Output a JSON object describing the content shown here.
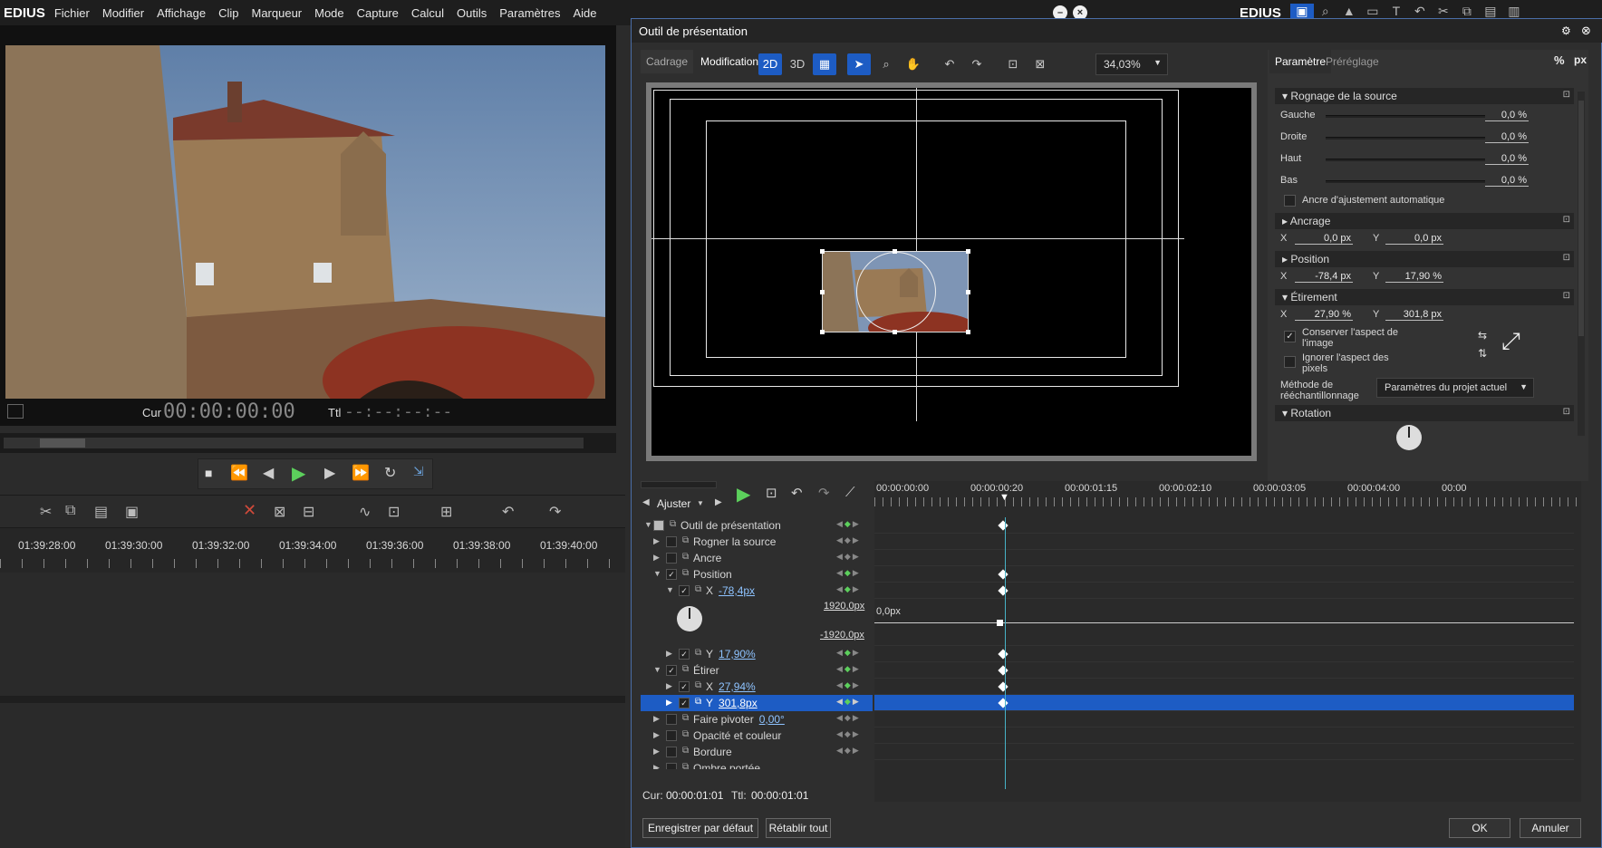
{
  "menubar": {
    "app": "EDIUS",
    "items": [
      "Fichier",
      "Modifier",
      "Affichage",
      "Clip",
      "Marqueur",
      "Mode",
      "Capture",
      "Calcul",
      "Outils",
      "Paramètres",
      "Aide"
    ]
  },
  "right_toolbar": {
    "app": "EDIUS"
  },
  "monitor": {
    "cur_label": "Cur",
    "cur_time": "00:00:00:00",
    "ttl_label": "Ttl",
    "ttl_time": "--:--:--:--"
  },
  "timeline_ruler": [
    "01:39:28:00",
    "01:39:30:00",
    "01:39:32:00",
    "01:39:34:00",
    "01:39:36:00",
    "01:39:38:00",
    "01:39:40:00"
  ],
  "dialog": {
    "title": "Outil de présentation",
    "tabs": [
      "Cadrage",
      "Modification"
    ],
    "zoom": "34,03%",
    "param_tabs": [
      "Paramètre",
      "Préréglage"
    ],
    "unit_percent": "%",
    "unit_px": "px",
    "crop": {
      "title": "Rognage de la source",
      "rows": [
        {
          "label": "Gauche",
          "value": "0,0 %"
        },
        {
          "label": "Droite",
          "value": "0,0 %"
        },
        {
          "label": "Haut",
          "value": "0,0 %"
        },
        {
          "label": "Bas",
          "value": "0,0 %"
        }
      ],
      "auto_anchor": "Ancre d'ajustement automatique"
    },
    "anchor": {
      "title": "Ancrage",
      "x_label": "X",
      "x": "0,0 px",
      "y_label": "Y",
      "y": "0,0 px"
    },
    "position": {
      "title": "Position",
      "x_label": "X",
      "x": "-78,4 px",
      "y_label": "Y",
      "y": "17,90 %"
    },
    "stretch": {
      "title": "Étirement",
      "x_label": "X",
      "x": "27,90 %",
      "y_label": "Y",
      "y": "301,8 px",
      "keep_aspect": "Conserver l'aspect de l'image",
      "ignore_pixel": "Ignorer l'aspect des pixels",
      "resample_label": "Méthode de rééchantillonnage",
      "resample_value": "Paramètres du projet actuel"
    },
    "rotation": {
      "title": "Rotation"
    },
    "kf_toolbar": {
      "fit": "Ajuster"
    },
    "kf_ruler": [
      "00:00:00:00",
      "00:00:00:20",
      "00:00:01:15",
      "00:00:02:10",
      "00:00:03:05",
      "00:00:04:00",
      "00:00"
    ],
    "kf_rows": [
      {
        "label": "Outil de présentation",
        "value": ""
      },
      {
        "label": "Rogner la source",
        "value": ""
      },
      {
        "label": "Ancre",
        "value": ""
      },
      {
        "label": "Position",
        "value": ""
      },
      {
        "label": "X",
        "value": "-78,4px"
      },
      {
        "label": "Y",
        "value": "17,90%"
      },
      {
        "label": "Étirer",
        "value": ""
      },
      {
        "label": "X",
        "value": "27,94%"
      },
      {
        "label": "Y",
        "value": "301,8px"
      },
      {
        "label": "Faire pivoter",
        "value": "0,00°"
      },
      {
        "label": "Opacité et couleur",
        "value": ""
      },
      {
        "label": "Bordure",
        "value": ""
      },
      {
        "label": "Ombre portée",
        "value": ""
      }
    ],
    "graph": {
      "max": "1920,0px",
      "min": "-1920,0px",
      "zero": "0,0px"
    },
    "footer_cur_label": "Cur:",
    "footer_cur": "00:00:01:01",
    "footer_ttl_label": "Ttl:",
    "footer_ttl": "00:00:01:01",
    "buttons": {
      "save_default": "Enregistrer par défaut",
      "reset_all": "Rétablir tout",
      "ok": "OK",
      "cancel": "Annuler"
    }
  },
  "colors": {
    "accent": "#1d5cc4",
    "playhead": "#47b2c6",
    "key_green": "#5cd05c"
  }
}
